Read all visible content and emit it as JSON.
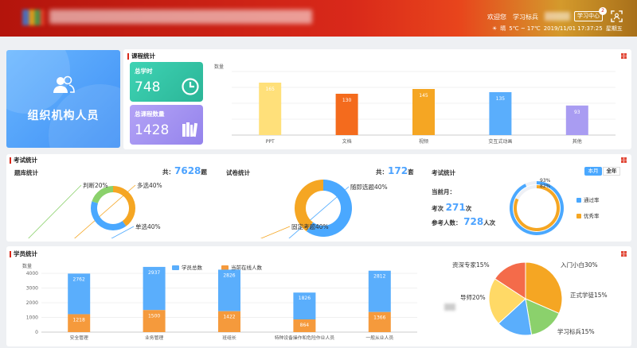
{
  "header": {
    "welcome": "欢迎您",
    "user": "学习标兵",
    "center_btn": "学习中心",
    "badge": "2",
    "weather": "晴",
    "temp": "5℃ ~ 17℃",
    "datetime": "2019/11/01 17:37:25",
    "weekday": "星期五"
  },
  "org": {
    "label": "组织机构人员"
  },
  "course": {
    "title": "课程统计",
    "hours_label": "总学时",
    "hours_value": "748",
    "count_label": "总课程数量",
    "count_value": "1428",
    "chart_data": {
      "type": "bar",
      "ylabel": "数量",
      "categories": [
        "PPT",
        "文档",
        "视频",
        "交互式动画",
        "其他"
      ],
      "values": [
        165,
        130,
        145,
        135,
        93
      ],
      "colors": [
        "#ffe07a",
        "#f46b1d",
        "#f5a623",
        "#5aaefc",
        "#a99cf2"
      ],
      "ylim": [
        0,
        200
      ]
    }
  },
  "exam": {
    "title": "考试统计",
    "bank": {
      "title": "题库统计",
      "total_label": "共：",
      "total_value": "7628",
      "unit": "题",
      "chart_data": {
        "type": "pie",
        "labels": [
          "多选",
          "单选",
          "判断"
        ],
        "values": [
          40,
          40,
          20
        ],
        "label_text": [
          "多选40%",
          "单选40%",
          "判断20%"
        ],
        "colors": [
          "#f5a623",
          "#4aa8ff",
          "#8bd16c"
        ]
      }
    },
    "paper": {
      "title": "试卷统计",
      "total_label": "共：",
      "total_value": "172",
      "unit": "套",
      "chart_data": {
        "type": "pie",
        "labels": [
          "随即选题",
          "固定考题"
        ],
        "values": [
          60,
          40
        ],
        "label_text": [
          "随即选题40%",
          "固定考题40%"
        ],
        "colors": [
          "#4aa8ff",
          "#f5a623"
        ]
      }
    },
    "stats": {
      "title": "考试统计",
      "tab_month": "本月",
      "tab_year": "全年",
      "current_label": "当前月：",
      "exams_label": "考次",
      "exams_value": "271",
      "exams_unit": "次",
      "people_label": "参考人数：",
      "people_value": "728",
      "people_unit": "人次",
      "chart_data": {
        "type": "pie",
        "series": [
          {
            "name": "通过率",
            "value": 93,
            "label": "93%",
            "color": "#4aa8ff"
          },
          {
            "name": "优秀率",
            "value": 82,
            "label": "82%",
            "color": "#f5a623"
          }
        ]
      }
    }
  },
  "student": {
    "title": "学员统计",
    "bar_chart": {
      "chart_data": {
        "type": "bar",
        "ylabel": "数量",
        "categories": [
          "安全管理",
          "业务管理",
          "班组长",
          "特种设备操作和危险作业人员",
          "一般从业人员"
        ],
        "series": [
          {
            "name": "学员总数",
            "color": "#5aaefc",
            "values": [
              2762,
              2937,
              2826,
              1826,
              2812
            ]
          },
          {
            "name": "当前在线人数",
            "color": "#f59a3c",
            "values": [
              1218,
              1500,
              1422,
              864,
              1366
            ]
          }
        ],
        "ylim": [
          0,
          4000
        ],
        "yticks": [
          "0",
          "1000",
          "2000",
          "3000",
          "4000"
        ]
      }
    },
    "pie": {
      "chart_data": {
        "type": "pie",
        "labels": [
          "入门小白",
          "正式学徒",
          "学习标兵",
          "导师",
          "资深专家"
        ],
        "values": [
          30,
          15,
          15,
          20,
          15
        ],
        "label_text": [
          "入门小白30%",
          "正式学徒15%",
          "学习标兵15%",
          "导师20%",
          "资深专家15%"
        ],
        "colors": [
          "#f5a623",
          "#8bd16c",
          "#5aaefc",
          "#ffd966",
          "#f46b4a"
        ]
      }
    }
  }
}
